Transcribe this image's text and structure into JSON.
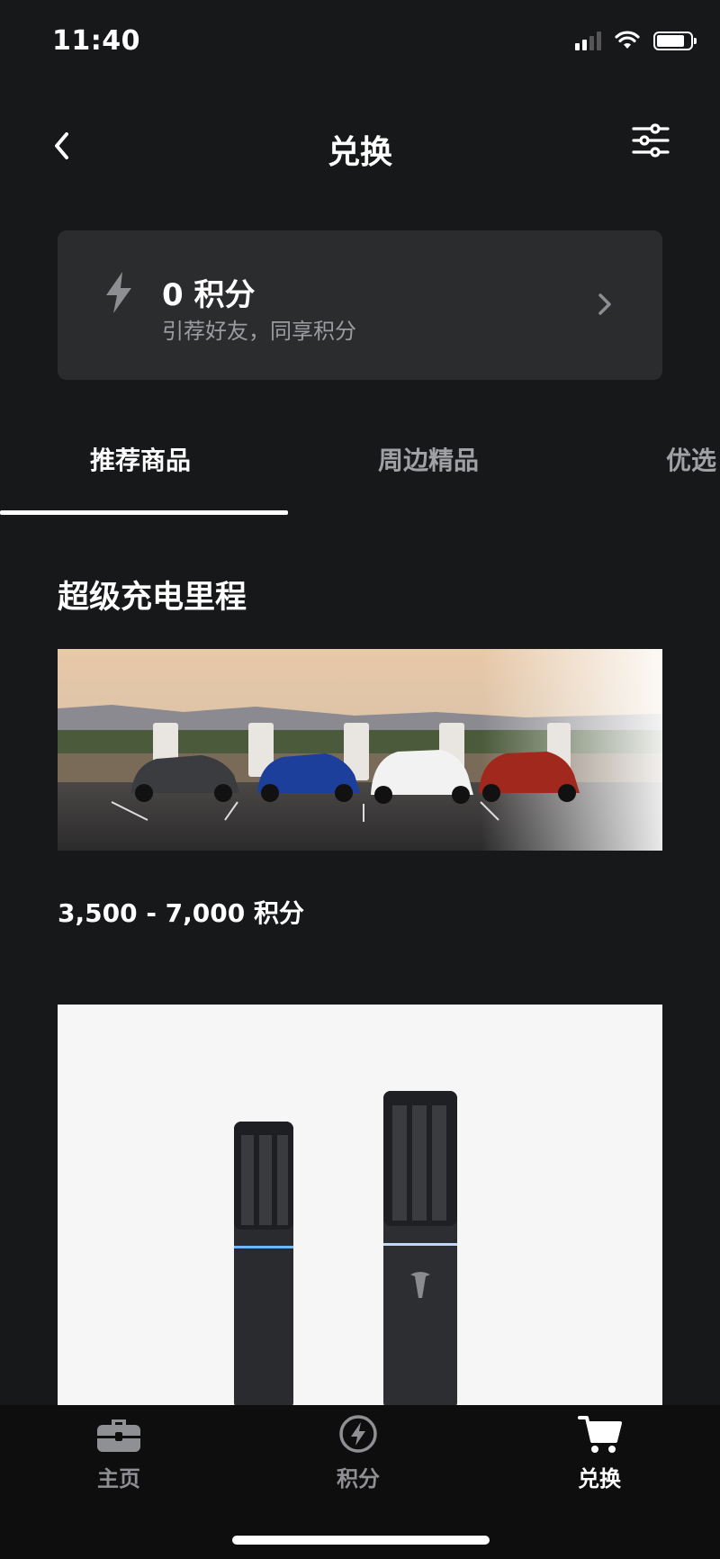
{
  "status_bar": {
    "time": "11:40"
  },
  "header": {
    "title": "兑换"
  },
  "points_card": {
    "value": "0 积分",
    "subtitle": "引荐好友，同享积分"
  },
  "tabs": [
    {
      "label": "推荐商品",
      "active": true
    },
    {
      "label": "周边精品",
      "active": false
    },
    {
      "label": "优选",
      "active": false
    }
  ],
  "section": {
    "title": "超级充电里程",
    "item_1_price": "3,500 - 7,000 积分"
  },
  "bottom_nav": [
    {
      "label": "主页",
      "icon": "toolbox-icon",
      "active": false
    },
    {
      "label": "积分",
      "icon": "bolt-circle-icon",
      "active": false
    },
    {
      "label": "兑换",
      "icon": "cart-icon",
      "active": true
    }
  ],
  "colors": {
    "background": "#17181a",
    "card": "#2b2c2e",
    "muted": "#9b9ca0",
    "tabbar": "#0e0e0f"
  }
}
